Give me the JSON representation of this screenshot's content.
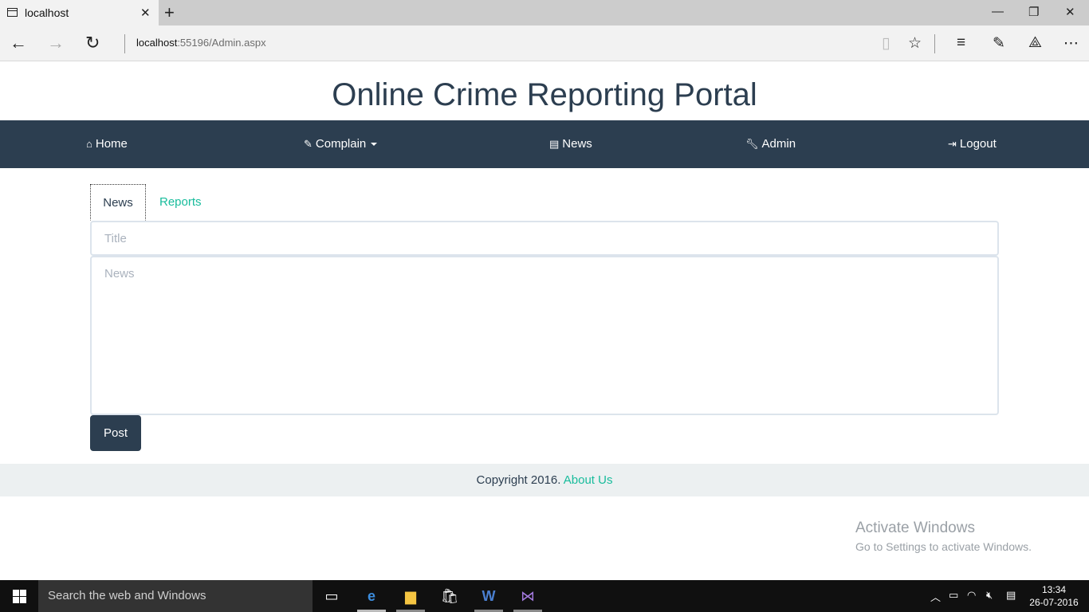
{
  "browser": {
    "tab_title": "localhost",
    "url_host": "localhost",
    "url_rest": ":55196/Admin.aspx"
  },
  "site": {
    "title": "Online Crime Reporting Portal"
  },
  "navbar": {
    "items": [
      {
        "label": "Home",
        "icon": "home-icon"
      },
      {
        "label": "Complain",
        "icon": "edit-icon"
      },
      {
        "label": "News",
        "icon": "newspaper-icon"
      },
      {
        "label": "Admin",
        "icon": "wrench-icon"
      },
      {
        "label": "Logout",
        "icon": "sign-out-icon"
      }
    ]
  },
  "tabs": [
    {
      "label": "News",
      "active": true
    },
    {
      "label": "Reports",
      "active": false
    }
  ],
  "form": {
    "title_placeholder": "Title",
    "news_placeholder": "News",
    "post_label": "Post"
  },
  "footer": {
    "text": "Copyright 2016.",
    "link": "About Us"
  },
  "watermark": {
    "title": "Activate Windows",
    "subtitle": "Go to Settings to activate Windows."
  },
  "taskbar": {
    "search_placeholder": "Search the web and Windows",
    "time": "13:34",
    "date": "26-07-2016"
  },
  "colors": {
    "primary": "#2c3e50",
    "accent": "#18bc9c",
    "footer_bg": "#ecf0f1"
  }
}
